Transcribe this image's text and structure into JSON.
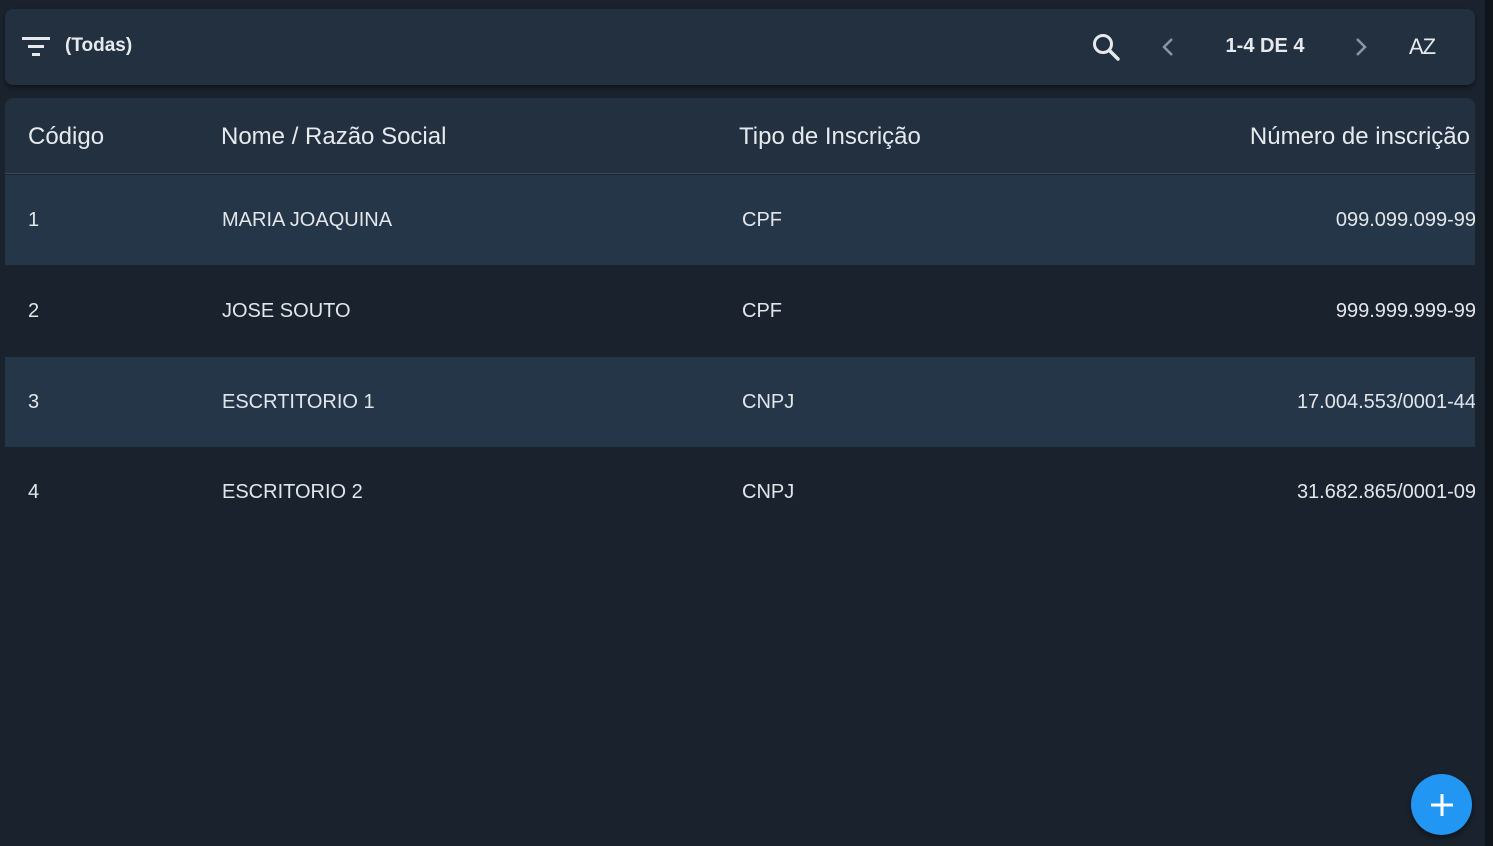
{
  "toolbar": {
    "filter_label": "(Todas)",
    "pagination": "1-4 DE 4",
    "sort_label": "AZ",
    "icons": {
      "filter": "filter-list-icon",
      "search": "search-icon",
      "prev": "chevron-left-icon",
      "next": "chevron-right-icon",
      "sort": "sort-alpha-icon"
    }
  },
  "table": {
    "headers": {
      "code": "Código",
      "name": "Nome / Razão Social",
      "type": "Tipo de Inscrição",
      "number": "Número de inscrição"
    },
    "rows": [
      {
        "code": "1",
        "name": "MARIA JOAQUINA",
        "type": "CPF",
        "number": "099.099.099-99"
      },
      {
        "code": "2",
        "name": "JOSE SOUTO",
        "type": "CPF",
        "number": "999.999.999-99"
      },
      {
        "code": "3",
        "name": "ESCRTITORIO 1",
        "type": "CNPJ",
        "number": "17.004.553/0001-44"
      },
      {
        "code": "4",
        "name": "ESCRITORIO 2",
        "type": "CNPJ",
        "number": "31.682.865/0001-09"
      }
    ]
  },
  "fab": {
    "icon": "add-icon"
  },
  "colors": {
    "background": "#1a222d",
    "toolbar": "#223040",
    "row_alt": "#253649",
    "accent": "#2196f3"
  }
}
